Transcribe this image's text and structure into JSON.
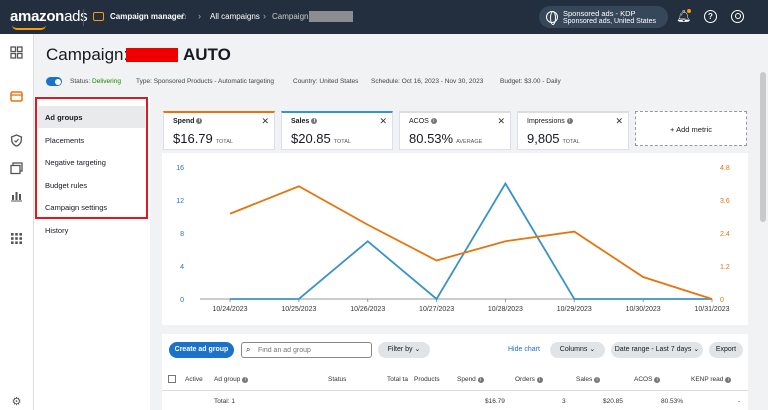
{
  "topbar": {
    "logo_main": "amazon",
    "logo_ads": "ads",
    "app_name": "Campaign manager",
    "crumb_all": "All campaigns",
    "crumb_campaign": "Campaign:",
    "account_line1": "Sponsored ads - KDP",
    "account_line2": "Sponsored ads, United States",
    "help": "?"
  },
  "header": {
    "title_prefix": "Campaign:",
    "title_suffix": "AUTO",
    "status_label": "Status: ",
    "status_value": "Delivering",
    "type": "Type: Sponsored Products - Automatic targeting",
    "country": "Country: United States",
    "schedule": "Schedule: Oct 16, 2023 - Nov 30, 2023",
    "budget": "Budget: $3.00 - Daily"
  },
  "sidenav": {
    "items": [
      {
        "label": "Ad groups"
      },
      {
        "label": "Placements"
      },
      {
        "label": "Negative targeting"
      },
      {
        "label": "Budget rules"
      },
      {
        "label": "Campaign settings"
      },
      {
        "label": "History"
      }
    ]
  },
  "metrics": [
    {
      "name": "Spend",
      "value": "$16.79",
      "suffix": "TOTAL",
      "color": "#e5740c",
      "bold": true
    },
    {
      "name": "Sales",
      "value": "$20.85",
      "suffix": "TOTAL",
      "color": "#3a93c7",
      "bold": true
    },
    {
      "name": "ACOS",
      "value": "80.53%",
      "suffix": "AVERAGE",
      "color": "#dddddd",
      "bold": false
    },
    {
      "name": "Impressions",
      "value": "9,805",
      "suffix": "TOTAL",
      "color": "#dddddd",
      "bold": false
    }
  ],
  "add_metric": "+ Add metric",
  "chart_data": {
    "type": "line",
    "x": [
      "10/24/2023",
      "10/25/2023",
      "10/26/2023",
      "10/27/2023",
      "10/28/2023",
      "10/29/2023",
      "10/30/2023",
      "10/31/2023"
    ],
    "left_ticks": [
      "16",
      "12",
      "8",
      "4",
      "0"
    ],
    "right_ticks": [
      "4.8",
      "3.6",
      "2.4",
      "1.2",
      "0"
    ],
    "ylim_left": [
      0,
      16
    ],
    "ylim_right": [
      0,
      4.8
    ],
    "series": [
      {
        "color": "#3a93c7",
        "axis": "left",
        "values": [
          0,
          0,
          7,
          0,
          14,
          0,
          0,
          0
        ]
      },
      {
        "color": "#e5740c",
        "axis": "right",
        "values": [
          3.1,
          4.1,
          2.7,
          1.4,
          2.1,
          2.45,
          0.8,
          0
        ]
      }
    ],
    "grid": false
  },
  "table": {
    "create_button": "Create ad group",
    "search_placeholder": "Find an ad group",
    "filter_label": "Filter by",
    "hide_chart": "Hide chart",
    "columns_label": "Columns",
    "date_range": "Date range - Last 7 days",
    "export": "Export",
    "headers": [
      "Active",
      "Ad group",
      "Status",
      "Total ta",
      "Products",
      "Spend",
      "Orders",
      "Sales",
      "ACOS",
      "KENP read"
    ],
    "total_row": {
      "label": "Total: 1",
      "spend": "$16.79",
      "orders": "3",
      "sales": "$20.85",
      "acos": "80.53%",
      "kenp": "-"
    }
  }
}
